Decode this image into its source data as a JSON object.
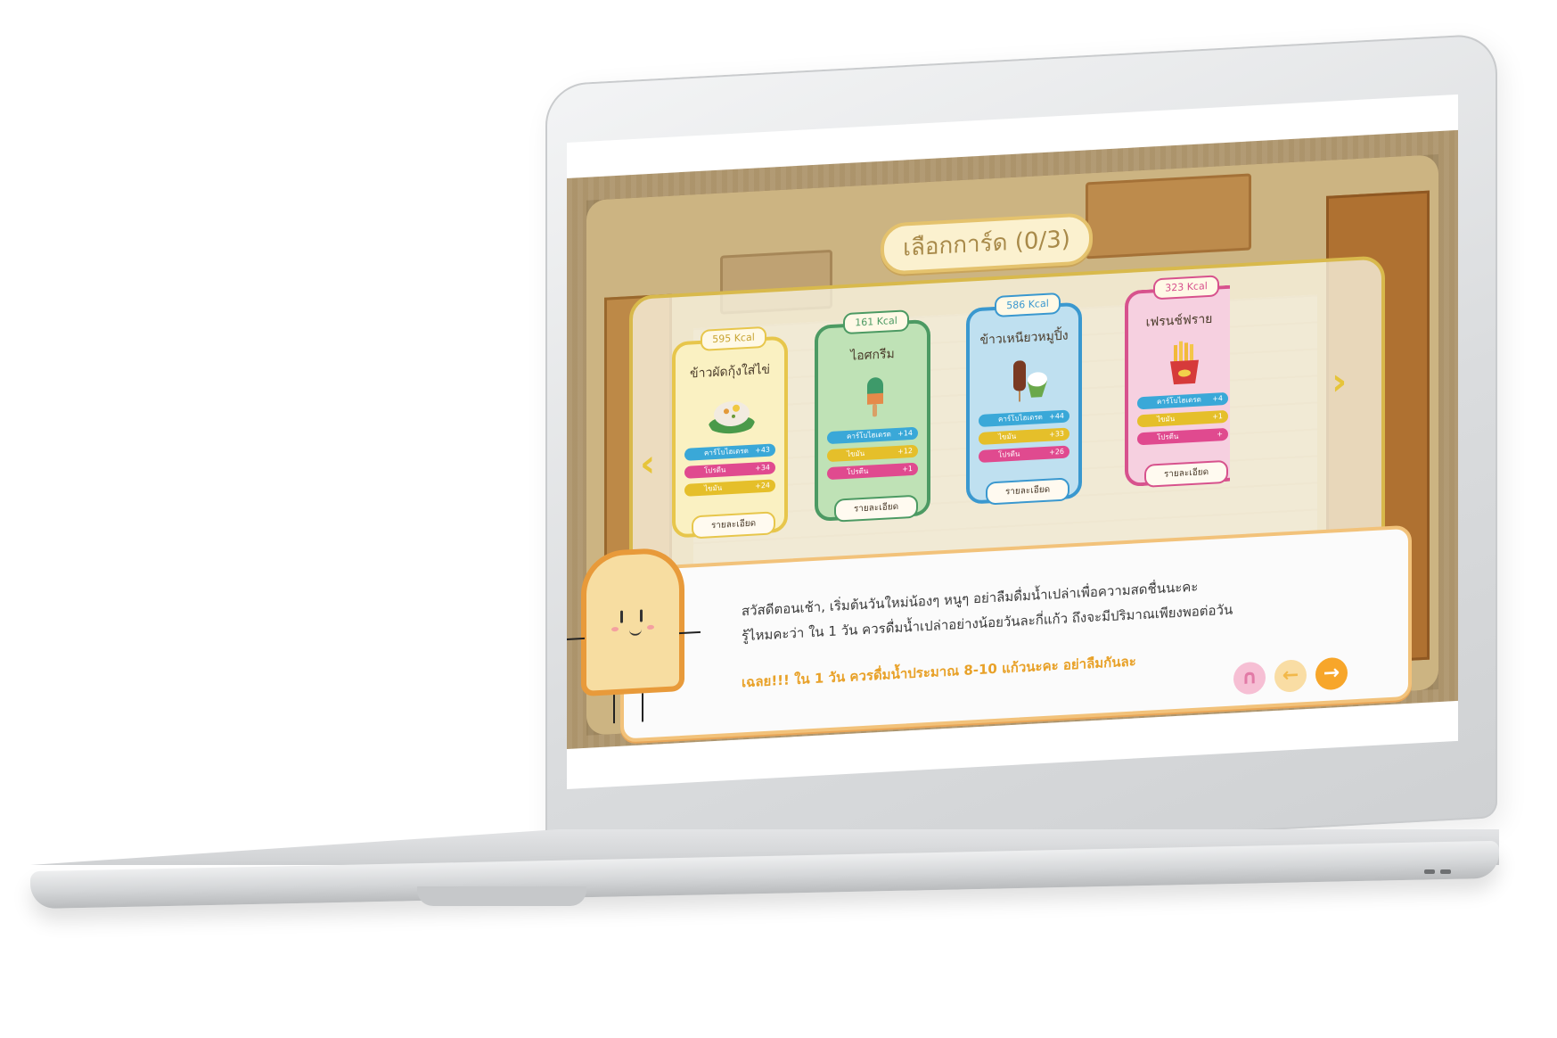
{
  "game": {
    "title": "เลือกการ์ด (0/3)",
    "nav": {
      "prev_icon": "chevron-left-icon",
      "next_icon": "chevron-right-icon"
    },
    "cards": [
      {
        "kcal": "595 Kcal",
        "name": "ข้าวผัดกุ้งใส่ไข่",
        "color": "#e7c64b",
        "stats": [
          {
            "label": "คาร์โบไฮเดรต",
            "value": "+43",
            "color": "blue"
          },
          {
            "label": "โปรตีน",
            "value": "+34",
            "color": "pink"
          },
          {
            "label": "ไขมัน",
            "value": "+24",
            "color": "yellow"
          }
        ],
        "detail": "รายละเอียด"
      },
      {
        "kcal": "161 Kcal",
        "name": "ไอศกรีม",
        "color": "#4c9a63",
        "stats": [
          {
            "label": "คาร์โบไฮเดรต",
            "value": "+14",
            "color": "blue"
          },
          {
            "label": "ไขมัน",
            "value": "+12",
            "color": "yellow"
          },
          {
            "label": "โปรตีน",
            "value": "+1",
            "color": "pink"
          }
        ],
        "detail": "รายละเอียด"
      },
      {
        "kcal": "586 Kcal",
        "name": "ข้าวเหนียวหมูปิ้ง",
        "color": "#3a98cf",
        "stats": [
          {
            "label": "คาร์โบไฮเดรต",
            "value": "+44",
            "color": "blue"
          },
          {
            "label": "ไขมัน",
            "value": "+33",
            "color": "yellow"
          },
          {
            "label": "โปรตีน",
            "value": "+26",
            "color": "pink"
          }
        ],
        "detail": "รายละเอียด"
      },
      {
        "kcal": "323 Kcal",
        "name": "เฟรนช์ฟราย",
        "color": "#d7528d",
        "stats": [
          {
            "label": "คาร์โบไฮเดรต",
            "value": "+4",
            "color": "blue"
          },
          {
            "label": "ไขมัน",
            "value": "+1",
            "color": "yellow"
          },
          {
            "label": "โปรตีน",
            "value": "+",
            "color": "pink"
          }
        ],
        "detail": "รายละเอียด"
      }
    ],
    "dialog": {
      "line1": "สวัสดีตอนเช้า, เริ่มต้นวันใหม่น้องๆ หนูๆ อย่าลืมดื่มน้ำเปล่าเพื่อความสดชื่นนะคะ",
      "line2": "รู้ไหมคะว่า ใน 1 วัน ควรดื่มน้ำเปล่าอย่างน้อยวันละกี่แก้ว ถึงจะมีปริมาณเพียงพอต่อวัน",
      "answer": "เฉลย!!!  ใน 1 วัน ควรดื่มน้ำประมาณ 8-10 แก้วนะคะ  อย่าลืมกันละ",
      "buttons": {
        "sound_icon": "headphones-icon",
        "prev_icon": "arrow-left-icon",
        "next_icon": "arrow-right-icon"
      }
    }
  }
}
